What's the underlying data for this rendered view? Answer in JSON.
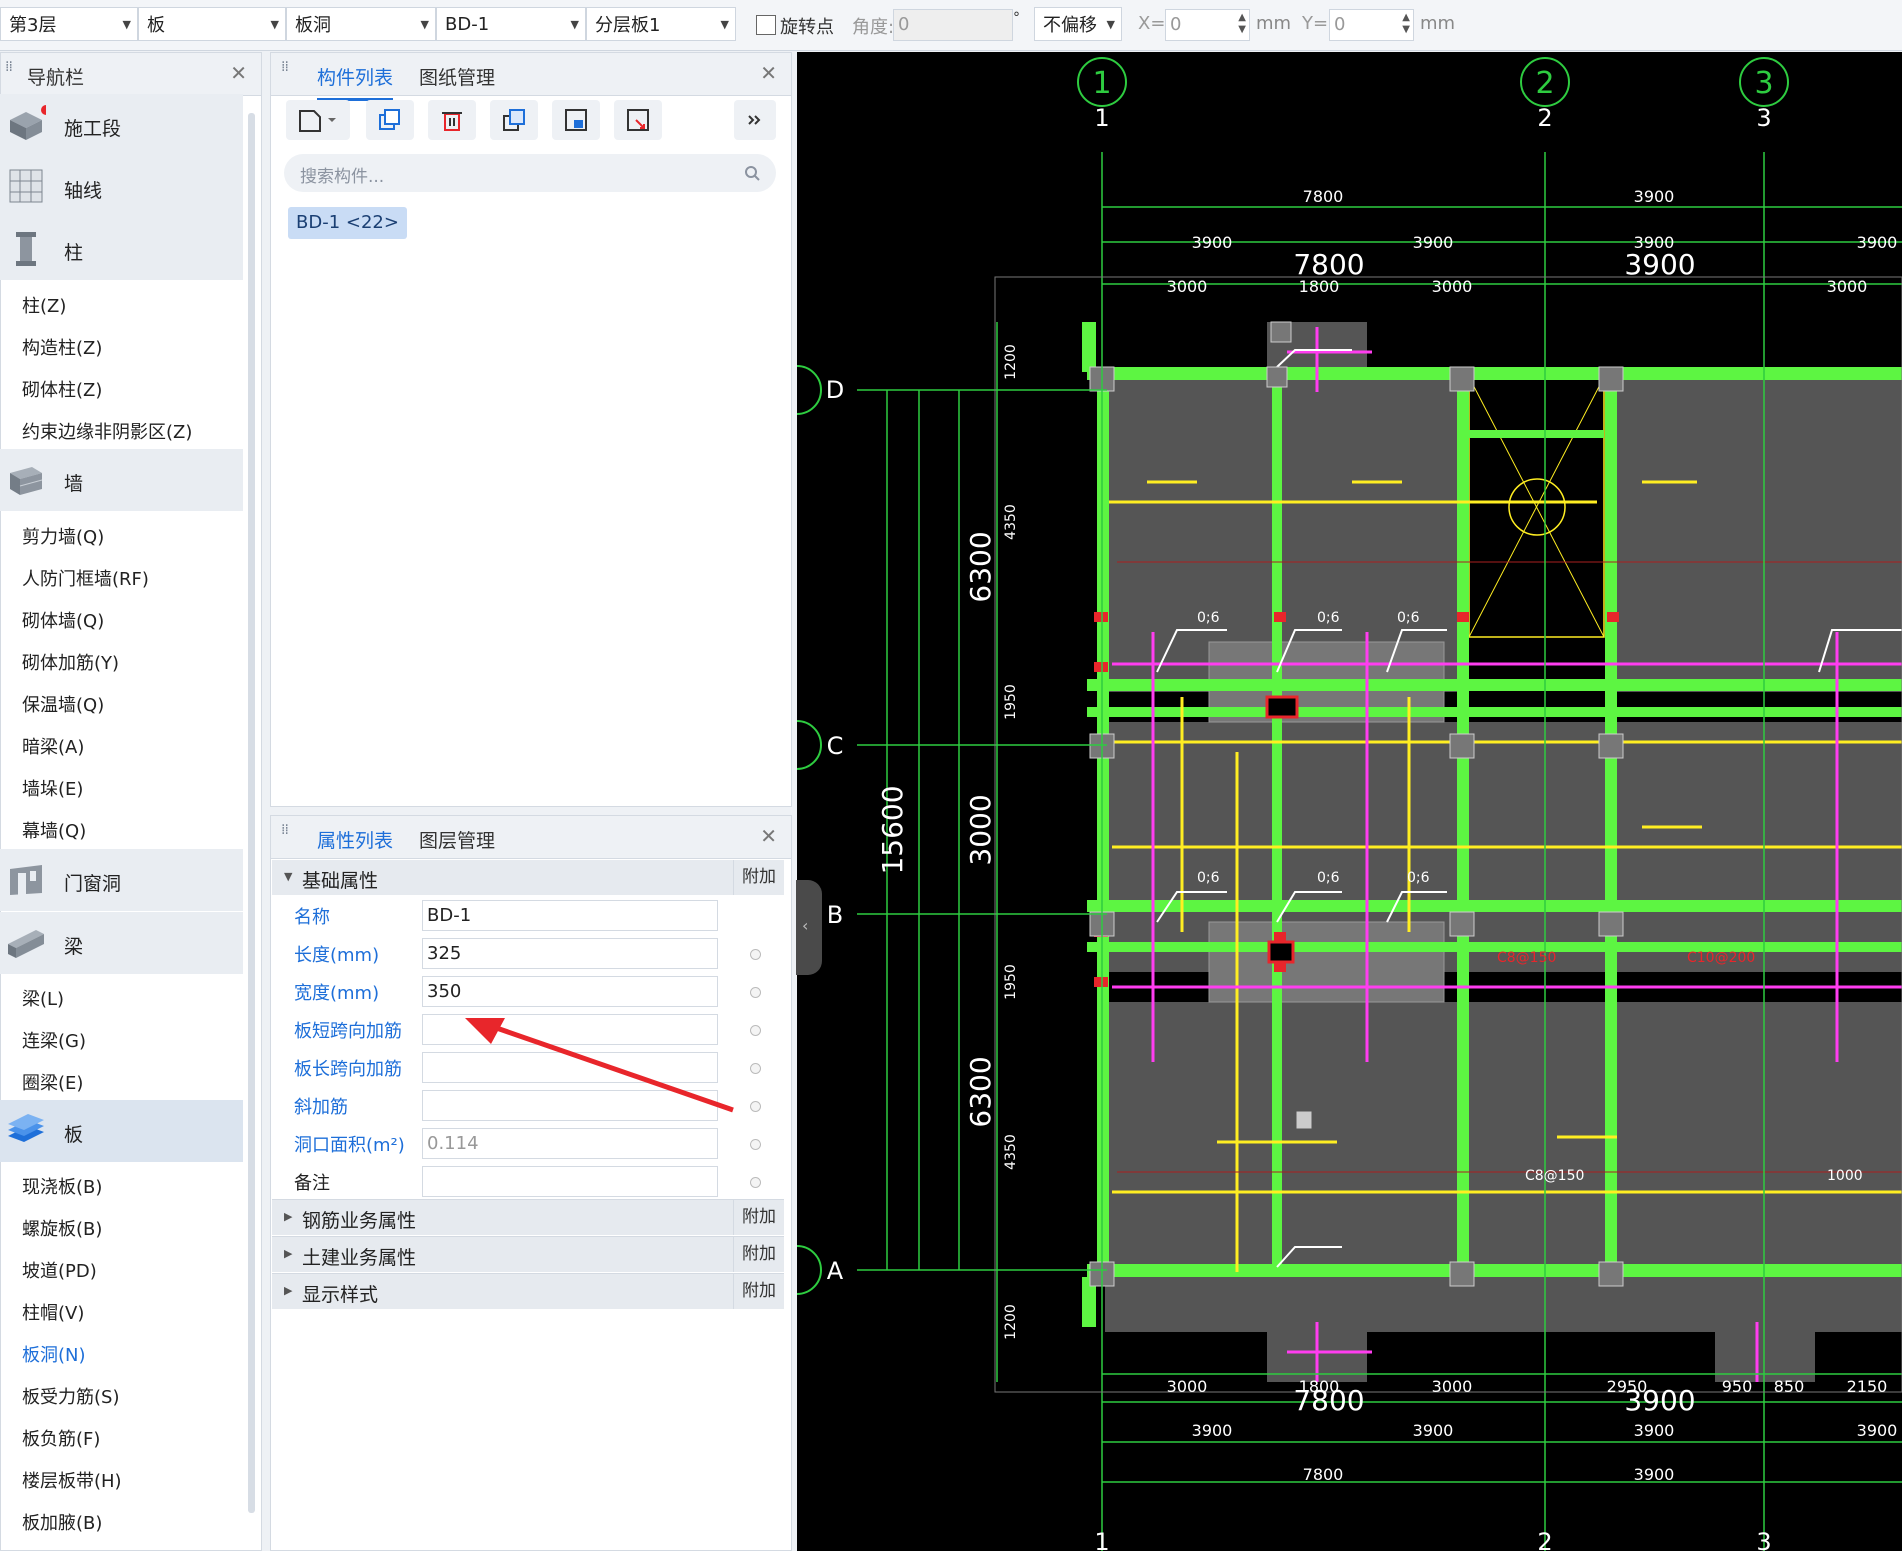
{
  "toolbar": {
    "floor": "第3层",
    "category": "板",
    "type": "板洞",
    "component": "BD-1",
    "layer": "分层板1",
    "rotate_point": "旋转点",
    "angle_label": "角度:",
    "angle_value": "0",
    "degree_unit": "°",
    "offset_mode": "不偏移",
    "x_label": "X=",
    "x_value": "0",
    "y_label": "Y=",
    "y_value": "0",
    "unit": "mm"
  },
  "nav": {
    "title": "导航栏",
    "groups": {
      "stage": "施工段",
      "axis": "轴线",
      "column": "柱",
      "wall": "墙",
      "opening": "门窗洞",
      "beam": "梁",
      "slab": "板"
    },
    "column_items": [
      "柱(Z)",
      "构造柱(Z)",
      "砌体柱(Z)",
      "约束边缘非阴影区(Z)"
    ],
    "wall_items": [
      "剪力墙(Q)",
      "人防门框墙(RF)",
      "砌体墙(Q)",
      "砌体加筋(Y)",
      "保温墙(Q)",
      "暗梁(A)",
      "墙垛(E)",
      "幕墙(Q)"
    ],
    "beam_items": [
      "梁(L)",
      "连梁(G)",
      "圈梁(E)"
    ],
    "slab_items": [
      "现浇板(B)",
      "螺旋板(B)",
      "坡道(PD)",
      "柱帽(V)",
      "板洞(N)",
      "板受力筋(S)",
      "板负筋(F)",
      "楼层板带(H)",
      "板加腋(B)"
    ]
  },
  "component_panel": {
    "tab_list": "构件列表",
    "tab_drawings": "图纸管理",
    "search_placeholder": "搜索构件...",
    "items": [
      "BD-1 <22>"
    ]
  },
  "property_panel": {
    "tab_props": "属性列表",
    "tab_layers": "图层管理",
    "section_basic": "基础属性",
    "add_label": "附加",
    "rows": [
      {
        "label": "名称",
        "value": "BD-1"
      },
      {
        "label": "长度(mm)",
        "value": "325"
      },
      {
        "label": "宽度(mm)",
        "value": "350"
      },
      {
        "label": "板短跨向加筋",
        "value": ""
      },
      {
        "label": "板长跨向加筋",
        "value": ""
      },
      {
        "label": "斜加筋",
        "value": ""
      },
      {
        "label": "洞口面积(m²)",
        "value": "0.114"
      },
      {
        "label": "备注",
        "value": ""
      }
    ],
    "sections": [
      "钢筋业务属性",
      "土建业务属性",
      "显示样式"
    ]
  },
  "drawing": {
    "axis_top": [
      "1",
      "2",
      "3"
    ],
    "axis_side": [
      "D",
      "C",
      "B",
      "A"
    ],
    "dims_top_total": [
      "7800",
      "3900"
    ],
    "dims_top_sub": [
      "3900",
      "3900",
      "3900",
      "3900"
    ],
    "dims_top_big": [
      "7800",
      "3900"
    ],
    "dims_top_detail": [
      "3000",
      "1800",
      "3000",
      "3000"
    ],
    "dims_left_outer": [
      "6300",
      "3000",
      "6300"
    ],
    "dims_left_total": "15600",
    "dims_left_inner": [
      "1200",
      "4350",
      "1950",
      "1950",
      "4350",
      "1200"
    ],
    "dims_bottom_detail": [
      "3000",
      "1800",
      "3000",
      "2950",
      "950",
      "850",
      "2150"
    ],
    "dims_bottom_big": [
      "7800",
      "3900"
    ],
    "dims_bottom_sub": [
      "3900",
      "3900",
      "3900",
      "3900"
    ],
    "dims_bottom_total": [
      "7800",
      "3900"
    ],
    "rebar_marks": [
      "C8@150",
      "C10@200",
      "1000",
      "0;6"
    ]
  },
  "colors": {
    "accent": "#1e6fd9",
    "canvas": "#000000",
    "dim_green": "#2ecc40",
    "beam_green": "#5df542",
    "rebar_yellow": "#ffee22",
    "rebar_magenta": "#ff3df0",
    "arrow_red": "#e8262b"
  }
}
